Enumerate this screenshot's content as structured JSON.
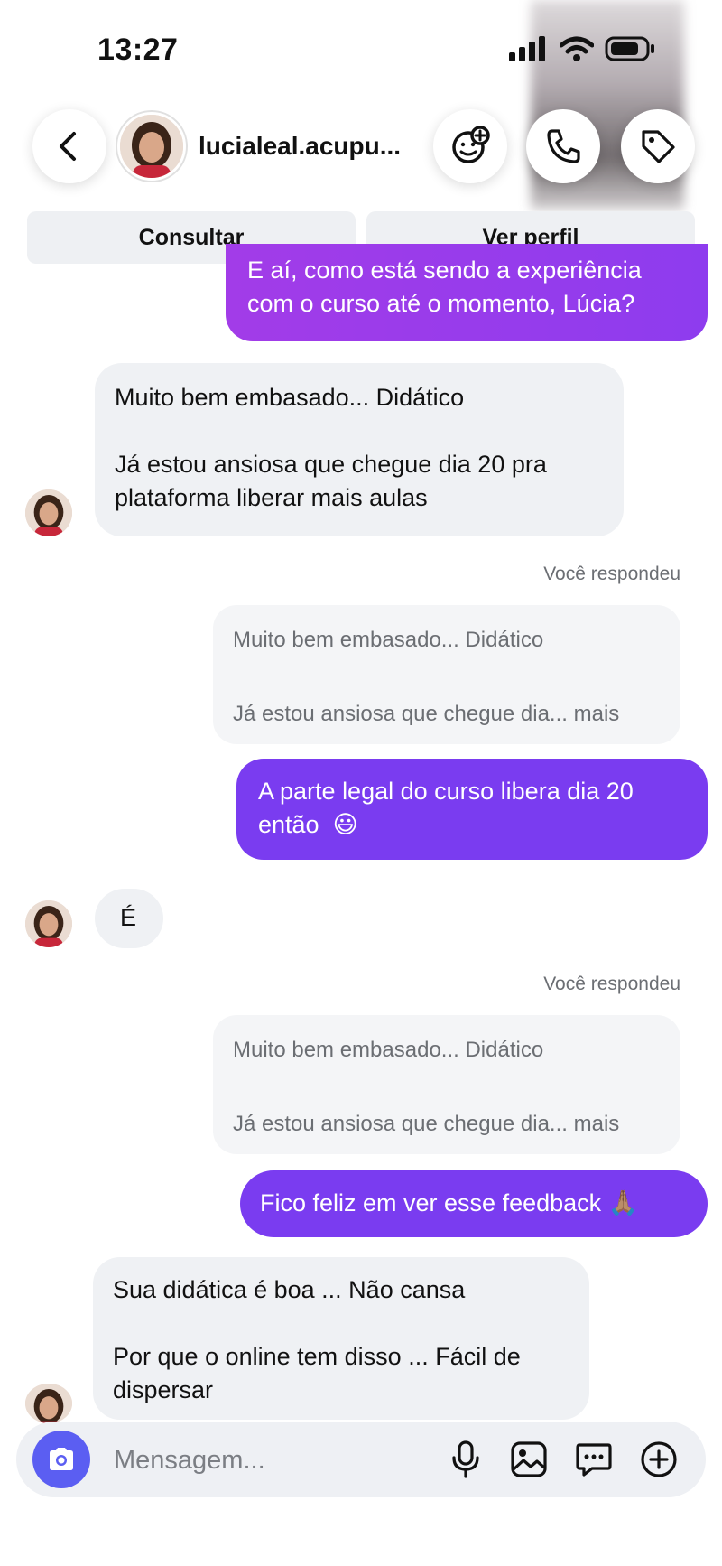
{
  "status_bar": {
    "time": "13:27"
  },
  "header": {
    "username": "lucialeal.acupu..."
  },
  "actions": {
    "consult_label": "Consultar",
    "profile_label": "Ver perfil"
  },
  "messages": [
    {
      "type": "outgoing",
      "lines": [
        "E aí, como está sendo a experiência",
        "com o curso até o momento, Lúcia?"
      ]
    },
    {
      "type": "incoming",
      "line1": "Muito bem embasado...  Didático",
      "line2a": "Já estou ansiosa que chegue dia 20 pra",
      "line2b": "plataforma liberar mais aulas"
    },
    {
      "type": "reply",
      "label": "Você respondeu",
      "quote1": "Muito bem embasado...  Didático",
      "quote2": "Já estou ansiosa que chegue dia... mais",
      "lines": [
        "A parte legal do curso libera dia 20",
        "então"
      ],
      "emoji": "😃"
    },
    {
      "type": "incoming",
      "text": "É"
    },
    {
      "type": "reply",
      "label": "Você respondeu",
      "quote1": "Muito bem embasado...  Didático",
      "quote2": "Já estou ansiosa que chegue dia... mais",
      "text": "Fico feliz em ver esse feedback",
      "emoji": "🙏🏽"
    },
    {
      "type": "incoming",
      "line1": "Sua didática é boa ... Não cansa",
      "line2a": "Por que o online tem disso ... Fácil de",
      "line2b": "dispersar"
    }
  ],
  "composer": {
    "placeholder": "Mensagem..."
  },
  "icons": [
    "back-icon",
    "sticker-icon",
    "phone-icon",
    "tag-icon",
    "camera-icon",
    "microphone-icon",
    "gallery-icon",
    "chat-icon",
    "plus-icon"
  ],
  "colors": {
    "outgoing_purple": "#7a3cf0",
    "outgoing_magenta": "#a43be9",
    "incoming_bg": "#eff1f4",
    "camera_btn": "#5b5ef2"
  }
}
